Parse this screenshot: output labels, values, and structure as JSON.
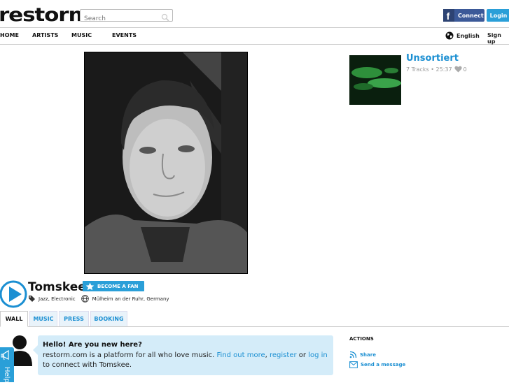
{
  "header": {
    "logo_text": "restorm",
    "search_placeholder": "Search",
    "facebook_label": "Connect",
    "facebook_icon_glyph": "f",
    "login_label": "Login"
  },
  "nav": {
    "items": [
      {
        "label": "HOME"
      },
      {
        "label": "ARTISTS"
      },
      {
        "label": "MUSIC"
      },
      {
        "label": "EVENTS"
      }
    ],
    "language": "English",
    "signup": "Sign up"
  },
  "playlist": {
    "title": "Unsortiert",
    "meta": "7 Tracks • 25:37",
    "likes": "0"
  },
  "artist": {
    "name": "Tomskee",
    "fan_button": "BECOME A FAN",
    "genres": "Jazz, Electronic",
    "location": "Mülheim an der Ruhr, Germany"
  },
  "tabs": [
    {
      "label": "WALL",
      "active": true
    },
    {
      "label": "MUSIC"
    },
    {
      "label": "PRESS"
    },
    {
      "label": "BOOKING"
    }
  ],
  "welcome": {
    "heading": "Hello! Are you new here?",
    "text_before": "restorm.com is a platform for all who love music. ",
    "link_find_out": "Find out more",
    "sep1": ", ",
    "link_register": "register",
    "sep2": " or ",
    "link_login": "log in",
    "text_after": " to connect with Tomskee."
  },
  "actions": {
    "heading": "ACTIONS",
    "share": "Share",
    "send_message": "Send a message"
  },
  "help_tab": {
    "label": "Help"
  },
  "colors": {
    "accent": "#2a9fd8",
    "link": "#1b8fd2",
    "facebook": "#3b5998",
    "bubble": "#d4ecf9"
  }
}
